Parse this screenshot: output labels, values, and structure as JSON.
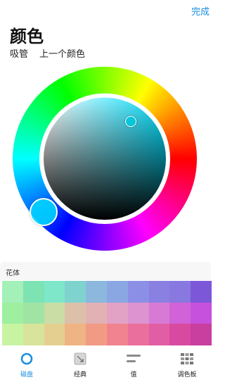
{
  "header": {
    "done_label": "完成",
    "title": "颜色"
  },
  "actions": {
    "eyedropper": "吸管",
    "previous_color": "上一个颜色"
  },
  "palette": {
    "section_label": "花体",
    "colors": [
      "#a3f0b8",
      "#7ee3b3",
      "#7ee6c9",
      "#7fd3cf",
      "#8bb8dc",
      "#8aa6e3",
      "#8c8fe6",
      "#8a80e2",
      "#8878df",
      "#7c58d9",
      "#9fefa0",
      "#a0e4a4",
      "#c9dda5",
      "#ddc0a8",
      "#e1b1b4",
      "#e1a2c5",
      "#dd93d0",
      "#d77ad6",
      "#d162d8",
      "#c651dc",
      "#c8f4a2",
      "#d8e49b",
      "#e5cf90",
      "#efb483",
      "#f19b85",
      "#f0838f",
      "#ea6f9c",
      "#e25ea4",
      "#d84aa0",
      "#c93fa0"
    ]
  },
  "tabs": [
    {
      "label": "磁盘",
      "icon": "disc-icon",
      "active": true
    },
    {
      "label": "经典",
      "icon": "classic-square-icon",
      "active": false
    },
    {
      "label": "值",
      "icon": "sliders-icon",
      "active": false
    },
    {
      "label": "调色板",
      "icon": "palette-grid-icon",
      "active": false
    }
  ],
  "colors": {
    "accent": "#1a8fe0",
    "selected": "#00e0ff"
  }
}
